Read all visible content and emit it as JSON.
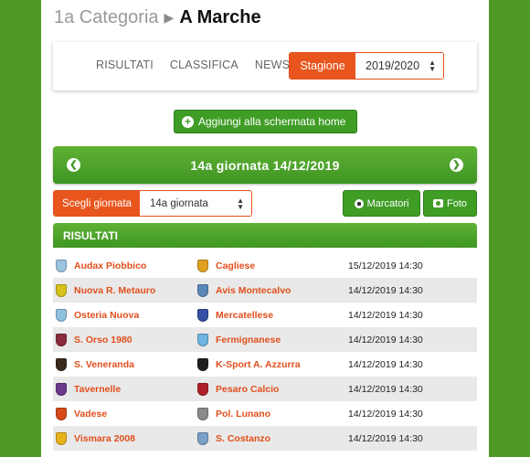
{
  "breadcrumb": {
    "category": "1a Categoria",
    "group": "A Marche"
  },
  "nav": {
    "items": [
      "RISULTATI",
      "CLASSIFICA",
      "NEWS"
    ]
  },
  "stagione": {
    "label": "Stagione",
    "value": "2019/2020"
  },
  "home_button": {
    "label": "Aggiungi alla schermata home"
  },
  "giornata_bar": {
    "title": "14a giornata 14/12/2019"
  },
  "scegli": {
    "label": "Scegli giornata",
    "value": "14a giornata"
  },
  "buttons": {
    "marcatori": "Marcatori",
    "foto": "Foto"
  },
  "results_header": "RISULTATI",
  "matches": [
    {
      "home": "Audax Piobbico",
      "away": "Cagliese",
      "date": "15/12/2019 14:30",
      "home_color": "#9cc3e0",
      "away_color": "#e0a020"
    },
    {
      "home": "Nuova R. Metauro",
      "away": "Avis Montecalvo",
      "date": "14/12/2019 14:30",
      "home_color": "#d8c21c",
      "away_color": "#5b86b6"
    },
    {
      "home": "Osteria Nuova",
      "away": "Mercatellese",
      "date": "14/12/2019 14:30",
      "home_color": "#8fc0e0",
      "away_color": "#3551a4"
    },
    {
      "home": "S. Orso 1980",
      "away": "Fermignanese",
      "date": "14/12/2019 14:30",
      "home_color": "#8a2b3c",
      "away_color": "#6fb4e2"
    },
    {
      "home": "S. Veneranda",
      "away": "K-Sport A. Azzurra",
      "date": "14/12/2019 14:30",
      "home_color": "#3a2a1e",
      "away_color": "#1e1e1e"
    },
    {
      "home": "Tavernelle",
      "away": "Pesaro Calcio",
      "date": "14/12/2019 14:30",
      "home_color": "#6a3a8c",
      "away_color": "#b0202a"
    },
    {
      "home": "Vadese",
      "away": "Pol. Lunano",
      "date": "14/12/2019 14:30",
      "home_color": "#d84a1a",
      "away_color": "#8a8a8a"
    },
    {
      "home": "Vismara 2008",
      "away": "S. Costanzo",
      "date": "14/12/2019 14:30",
      "home_color": "#e8b21a",
      "away_color": "#7aa0c8"
    }
  ]
}
